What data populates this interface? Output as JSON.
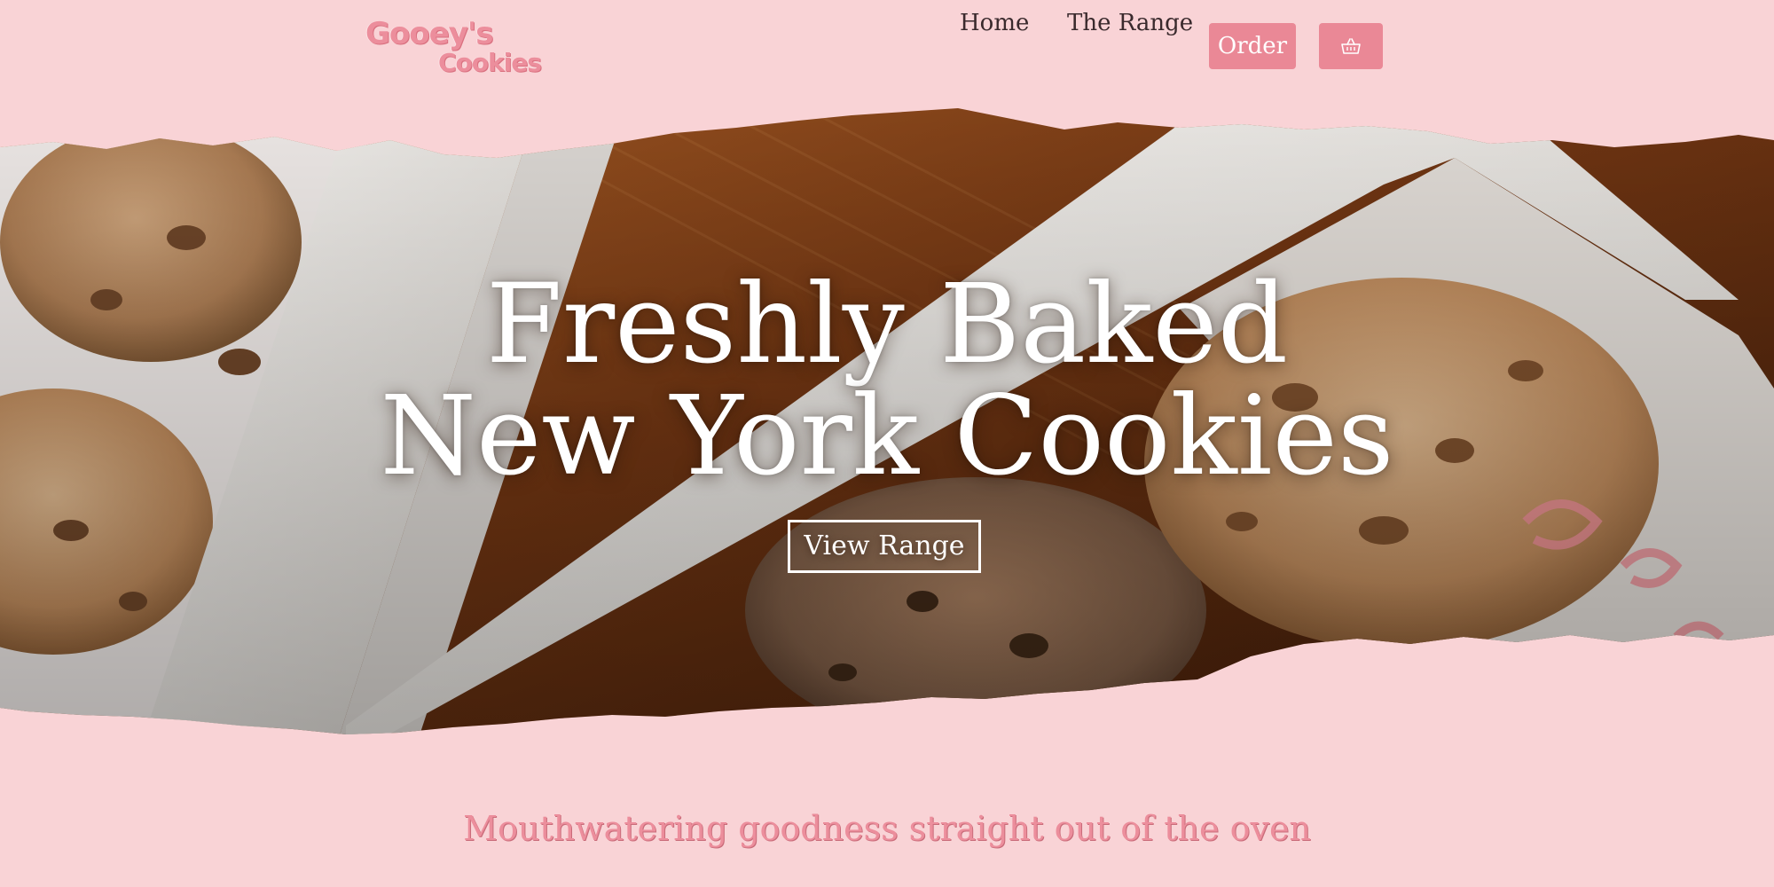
{
  "brand": {
    "logo_line1": "Gooey's",
    "logo_line2": "Cookies"
  },
  "nav": {
    "items": [
      {
        "label": "Home"
      },
      {
        "label": "The Range"
      }
    ],
    "order_label": "Order",
    "cart_icon": "basket-icon"
  },
  "hero": {
    "title_line1": "Freshly Baked",
    "title_line2": "New York Cookies",
    "cta_label": "View Range",
    "image_subject": "cookie-box-photo"
  },
  "tagline": "Mouthwatering goodness straight out of the oven",
  "colors": {
    "background": "#f9d3d6",
    "accent": "#ea8896",
    "logo_pink": "#ec8e9c",
    "nav_text": "#3a2a2d"
  }
}
